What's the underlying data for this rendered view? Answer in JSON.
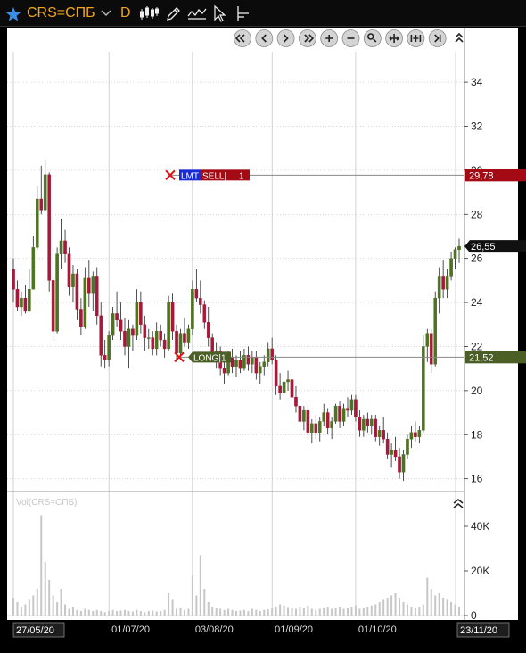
{
  "toolbar": {
    "star_icon": "star-icon",
    "symbol": "CRS=СПБ",
    "dropdown_icon": "chevron-down-icon",
    "period": "D",
    "tools": [
      "candles-icon",
      "pencil-icon",
      "indicator-icon",
      "cursor-icon",
      "ruler-icon"
    ]
  },
  "nav_buttons": [
    "rewind-icon",
    "back-icon",
    "forward-icon",
    "fast-forward-icon",
    "zoom-in-icon",
    "zoom-out-icon",
    "zoom-fit-icon",
    "expand-icon",
    "compress-icon",
    "end-icon",
    "collapse-icon"
  ],
  "colors": {
    "up": "#4d7321",
    "down": "#a31a3a",
    "sell_line": "#a30a14",
    "long_line": "#4b5e26",
    "grid": "#b5b5b5",
    "background": "#ffffff",
    "panel": "#000000"
  },
  "orders": {
    "sell": {
      "type": "LMT",
      "side": "SELL",
      "qty": "1",
      "price": 29.78,
      "price_label": "29,78"
    },
    "long": {
      "side": "LONG",
      "qty": "1",
      "price": 21.52,
      "price_label": "21,52"
    }
  },
  "last_price": {
    "value": 26.55,
    "label": "26,55"
  },
  "volume_panel": {
    "label": "Vol(CRS=СПБ)",
    "y_ticks": [
      "40K",
      "20K",
      "0"
    ]
  },
  "start_date_label": "27/05/20",
  "end_date_label": "23/11/20",
  "chart_data": {
    "type": "candlestick",
    "price_axis": {
      "ylim": [
        15.5,
        35.3
      ],
      "ticks": [
        16,
        18,
        20,
        22,
        24,
        26,
        28,
        30,
        32,
        34
      ]
    },
    "volume_axis": {
      "ylim": [
        0,
        48000
      ],
      "ticks": [
        0,
        20000,
        40000
      ]
    },
    "x_labels": [
      "01/07/20",
      "03/08/20",
      "01/09/20",
      "01/10/20"
    ],
    "x_label_index": [
      24,
      45,
      65,
      86
    ],
    "candles": [
      [
        25.5,
        26.0,
        24.0,
        24.6
      ],
      [
        24.6,
        25.0,
        23.6,
        23.8
      ],
      [
        23.8,
        24.5,
        23.4,
        24.2
      ],
      [
        24.2,
        24.8,
        23.5,
        23.6
      ],
      [
        23.6,
        25.5,
        23.6,
        24.6
      ],
      [
        24.6,
        27.0,
        24.6,
        26.5
      ],
      [
        26.5,
        29.3,
        26.4,
        28.7
      ],
      [
        28.7,
        30.2,
        28.0,
        28.2
      ],
      [
        28.2,
        30.5,
        29.0,
        29.8
      ],
      [
        29.8,
        29.9,
        24.5,
        25.0
      ],
      [
        25.0,
        25.2,
        22.3,
        22.7
      ],
      [
        22.7,
        26.5,
        22.6,
        26.2
      ],
      [
        26.2,
        27.8,
        25.5,
        26.8
      ],
      [
        26.8,
        27.3,
        25.8,
        26.2
      ],
      [
        26.2,
        26.5,
        24.3,
        24.7
      ],
      [
        24.7,
        25.7,
        24.0,
        25.3
      ],
      [
        25.3,
        25.5,
        23.2,
        23.7
      ],
      [
        23.7,
        24.2,
        22.5,
        22.9
      ],
      [
        22.9,
        25.6,
        22.8,
        25.1
      ],
      [
        25.1,
        25.9,
        23.8,
        24.4
      ],
      [
        24.4,
        25.4,
        23.6,
        25.2
      ],
      [
        25.2,
        25.6,
        23.0,
        23.4
      ],
      [
        23.4,
        24.0,
        21.1,
        21.6
      ],
      [
        21.6,
        22.3,
        21.0,
        21.4
      ],
      [
        21.4,
        22.7,
        21.1,
        22.5
      ],
      [
        22.5,
        23.8,
        22.3,
        23.5
      ],
      [
        23.5,
        24.5,
        22.9,
        23.2
      ],
      [
        23.2,
        24.0,
        22.3,
        22.7
      ],
      [
        22.7,
        23.3,
        21.6,
        22.0
      ],
      [
        22.0,
        23.2,
        21.0,
        22.8
      ],
      [
        22.8,
        23.0,
        21.8,
        22.5
      ],
      [
        22.5,
        24.6,
        22.3,
        24.0
      ],
      [
        24.0,
        24.5,
        22.6,
        23.0
      ],
      [
        23.0,
        23.4,
        21.8,
        22.4
      ],
      [
        22.4,
        22.8,
        21.9,
        22.4
      ],
      [
        22.4,
        22.7,
        21.6,
        21.9
      ],
      [
        21.9,
        23.1,
        21.6,
        22.7
      ],
      [
        22.7,
        23.0,
        22.0,
        22.3
      ],
      [
        22.3,
        22.6,
        21.5,
        21.9
      ],
      [
        21.9,
        24.3,
        21.8,
        24.0
      ],
      [
        24.0,
        24.4,
        22.3,
        22.7
      ],
      [
        22.7,
        23.0,
        21.3,
        21.7
      ],
      [
        21.7,
        22.8,
        21.4,
        22.6
      ],
      [
        22.6,
        23.3,
        22.0,
        22.2
      ],
      [
        22.2,
        23.0,
        21.9,
        22.8
      ],
      [
        22.8,
        25.0,
        22.5,
        24.6
      ],
      [
        24.6,
        25.5,
        24.0,
        24.2
      ],
      [
        24.2,
        25.0,
        23.5,
        23.9
      ],
      [
        23.9,
        24.1,
        22.8,
        23.1
      ],
      [
        23.1,
        23.8,
        22.0,
        22.4
      ],
      [
        22.4,
        22.6,
        21.3,
        21.6
      ],
      [
        21.6,
        22.2,
        21.0,
        21.8
      ],
      [
        21.8,
        22.0,
        20.7,
        21.0
      ],
      [
        21.0,
        21.6,
        20.3,
        20.8
      ],
      [
        20.8,
        21.8,
        20.7,
        21.5
      ],
      [
        21.5,
        21.9,
        20.8,
        21.1
      ],
      [
        21.1,
        21.6,
        20.6,
        21.4
      ],
      [
        21.4,
        21.8,
        20.8,
        21.0
      ],
      [
        21.0,
        21.9,
        20.9,
        21.6
      ],
      [
        21.6,
        22.0,
        20.9,
        21.2
      ],
      [
        21.2,
        21.8,
        20.8,
        21.5
      ],
      [
        21.5,
        21.8,
        20.5,
        20.8
      ],
      [
        20.8,
        21.3,
        20.3,
        21.1
      ],
      [
        21.1,
        21.6,
        20.7,
        21.3
      ],
      [
        21.3,
        22.2,
        21.1,
        21.9
      ],
      [
        21.9,
        22.4,
        21.2,
        21.4
      ],
      [
        21.4,
        21.6,
        19.8,
        20.2
      ],
      [
        20.2,
        20.8,
        19.6,
        19.9
      ],
      [
        19.9,
        20.7,
        19.2,
        20.4
      ],
      [
        20.4,
        20.9,
        20.0,
        20.5
      ],
      [
        20.5,
        20.8,
        19.4,
        19.7
      ],
      [
        19.7,
        20.2,
        19.0,
        19.3
      ],
      [
        19.3,
        19.6,
        18.3,
        18.6
      ],
      [
        18.6,
        19.3,
        18.2,
        19.1
      ],
      [
        19.1,
        19.4,
        17.8,
        18.1
      ],
      [
        18.1,
        18.7,
        17.6,
        18.5
      ],
      [
        18.5,
        18.9,
        17.8,
        18.1
      ],
      [
        18.1,
        18.8,
        17.7,
        18.6
      ],
      [
        18.6,
        19.4,
        18.4,
        19.0
      ],
      [
        19.0,
        19.2,
        18.0,
        18.3
      ],
      [
        18.3,
        18.8,
        17.8,
        18.6
      ],
      [
        18.6,
        19.4,
        18.5,
        19.3
      ],
      [
        19.3,
        19.5,
        18.3,
        18.6
      ],
      [
        18.6,
        19.4,
        18.4,
        19.2
      ],
      [
        19.2,
        19.7,
        18.8,
        19.1
      ],
      [
        19.1,
        19.8,
        18.9,
        19.6
      ],
      [
        19.6,
        19.8,
        18.6,
        18.8
      ],
      [
        18.8,
        19.1,
        17.9,
        18.2
      ],
      [
        18.2,
        18.9,
        17.9,
        18.7
      ],
      [
        18.7,
        19.0,
        18.1,
        18.4
      ],
      [
        18.4,
        18.9,
        18.0,
        18.7
      ],
      [
        18.7,
        18.9,
        17.7,
        17.9
      ],
      [
        17.9,
        18.4,
        17.5,
        18.2
      ],
      [
        18.2,
        18.8,
        17.6,
        17.8
      ],
      [
        17.8,
        18.1,
        16.9,
        17.1
      ],
      [
        17.1,
        17.6,
        16.5,
        17.3
      ],
      [
        17.3,
        17.9,
        16.8,
        17.0
      ],
      [
        17.0,
        17.4,
        16.0,
        16.3
      ],
      [
        16.3,
        17.3,
        15.9,
        17.1
      ],
      [
        17.1,
        18.0,
        16.9,
        17.8
      ],
      [
        17.8,
        18.4,
        17.4,
        18.1
      ],
      [
        18.1,
        18.6,
        17.7,
        17.9
      ],
      [
        17.9,
        18.4,
        17.6,
        18.2
      ],
      [
        18.2,
        22.5,
        18.1,
        22.0
      ],
      [
        22.0,
        22.8,
        21.3,
        22.6
      ],
      [
        22.6,
        22.8,
        20.8,
        21.2
      ],
      [
        21.2,
        24.5,
        21.1,
        24.2
      ],
      [
        24.2,
        25.6,
        23.5,
        25.2
      ],
      [
        25.2,
        25.9,
        24.2,
        24.6
      ],
      [
        24.6,
        25.5,
        24.2,
        25.2
      ],
      [
        25.2,
        26.3,
        25.0,
        26.0
      ],
      [
        26.0,
        26.5,
        25.5,
        26.4
      ],
      [
        26.4,
        26.9,
        25.8,
        26.55
      ]
    ],
    "volume": [
      8000,
      6000,
      4000,
      5000,
      7000,
      9000,
      12000,
      45000,
      24000,
      16000,
      9000,
      6000,
      12000,
      5000,
      3000,
      4000,
      2500,
      2000,
      3000,
      2500,
      2000,
      2500,
      2000,
      1500,
      2000,
      2500,
      2000,
      2200,
      2500,
      2000,
      1800,
      2500,
      2000,
      1500,
      2000,
      2200,
      1800,
      2000,
      2500,
      10000,
      7000,
      3000,
      3500,
      2500,
      3000,
      18000,
      9000,
      27000,
      12000,
      6000,
      4000,
      3500,
      3000,
      2500,
      3000,
      2500,
      2000,
      2200,
      2500,
      2000,
      3000,
      2500,
      2000,
      2500,
      2800,
      3500,
      4000,
      5000,
      4500,
      3800,
      3500,
      3000,
      4000,
      3500,
      4500,
      3000,
      2500,
      3000,
      3500,
      4000,
      3000,
      3500,
      4000,
      3000,
      3500,
      4000,
      4500,
      3000,
      3500,
      4000,
      4500,
      5000,
      6000,
      7000,
      8000,
      9000,
      10000,
      8000,
      6000,
      5000,
      4000,
      3500,
      4000,
      5000,
      17000,
      12000,
      9000,
      10000,
      8000,
      7000,
      6000,
      5000,
      4000
    ]
  }
}
